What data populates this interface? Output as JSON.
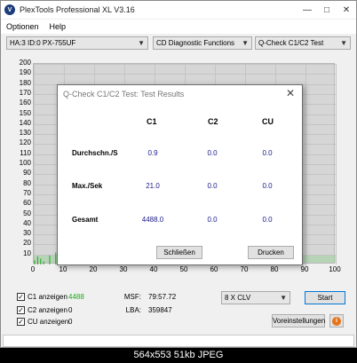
{
  "window": {
    "title": "PlexTools Professional XL V3.16",
    "icon_label": "V"
  },
  "menu": [
    "Optionen",
    "Help"
  ],
  "toolbar": {
    "drive": "HA:3 ID:0  PX-755UF",
    "function": "CD Diagnostic Functions",
    "test": "Q-Check C1/C2 Test"
  },
  "chart": {
    "yticks": [
      "200",
      "190",
      "180",
      "170",
      "160",
      "150",
      "140",
      "130",
      "120",
      "110",
      "100",
      "90",
      "80",
      "70",
      "60",
      "50",
      "40",
      "30",
      "20",
      "10"
    ],
    "xticks": [
      "0",
      "10",
      "20",
      "30",
      "40",
      "50",
      "60",
      "70",
      "80",
      "90",
      "100"
    ]
  },
  "dialog": {
    "title": "Q-Check C1/C2 Test: Test Results",
    "columns": [
      "C1",
      "C2",
      "CU"
    ],
    "rows": [
      {
        "label": "Durchschn./S",
        "values": [
          "0.9",
          "0.0",
          "0.0"
        ]
      },
      {
        "label": "Max./Sek",
        "values": [
          "21.0",
          "0.0",
          "0.0"
        ]
      },
      {
        "label": "Gesamt",
        "values": [
          "4488.0",
          "0.0",
          "0.0"
        ]
      }
    ],
    "close_button": "Schließen",
    "print_button": "Drucken"
  },
  "bottom": {
    "c1_label": "C1 anzeigen",
    "c1_value": "4488",
    "c2_label": "C2 anzeigen",
    "c2_value": "0",
    "cu_label": "CU anzeigen",
    "cu_value": "0",
    "msf_label": "MSF:",
    "msf_value": "79:57.72",
    "lba_label": "LBA:",
    "lba_value": "359847",
    "speed": "8 X CLV",
    "start_button": "Start",
    "settings_button": "Voreinstellungen",
    "help_icon_label": "i"
  },
  "caption": "564x553 51kb JPEG",
  "chart_data": {
    "type": "bar",
    "title": "",
    "xlabel": "",
    "ylabel": "",
    "xlim": [
      0,
      100
    ],
    "ylim": [
      0,
      200
    ],
    "series": [
      {
        "values_x": [
          0,
          1,
          2,
          3,
          5,
          7,
          9,
          11,
          13,
          15,
          17,
          20,
          23,
          26,
          30,
          35,
          40,
          45,
          50,
          55,
          60,
          65,
          70,
          75,
          80
        ],
        "values_y": [
          4,
          8,
          6,
          3,
          9,
          12,
          21,
          7,
          5,
          4,
          3,
          6,
          2,
          5,
          3,
          2,
          4,
          2,
          3,
          2,
          2,
          3,
          2,
          2,
          3
        ]
      }
    ],
    "colors": {
      "c1": "#1ea81e",
      "pass_band": "#7fd07f"
    }
  }
}
